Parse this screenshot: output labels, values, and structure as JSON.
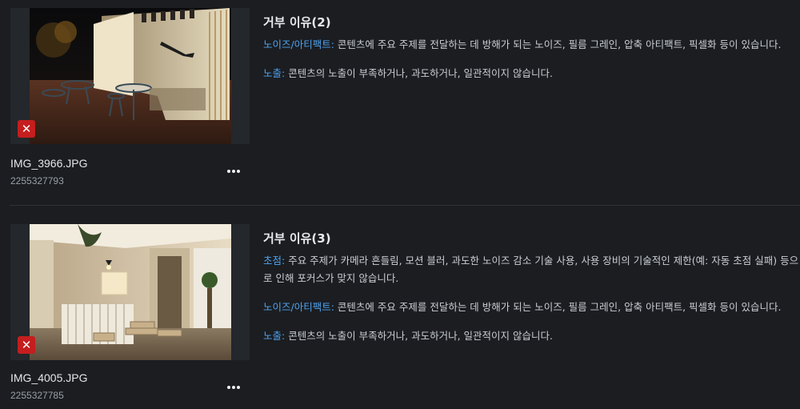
{
  "colors": {
    "background": "#1b1d21",
    "accent_label": "#4ea3f0",
    "reject_badge": "#c41e1e"
  },
  "items": [
    {
      "filename": "IMG_3966.JPG",
      "file_id": "2255327793",
      "reject_icon": "close-icon",
      "more_icon": "more-horizontal-icon",
      "reason_title": "거부 이유(2)",
      "reasons": [
        {
          "label": "노이즈/아티팩트:",
          "text": " 콘텐츠에 주요 주제를 전달하는 데 방해가 되는 노이즈, 필름 그레인, 압축 아티팩트, 픽셀화 등이 있습니다."
        },
        {
          "label": "노출:",
          "text": " 콘텐츠의 노출이 부족하거나, 과도하거나, 일관적이지 않습니다."
        }
      ]
    },
    {
      "filename": "IMG_4005.JPG",
      "file_id": "2255327785",
      "reject_icon": "close-icon",
      "more_icon": "more-horizontal-icon",
      "reason_title": "거부 이유(3)",
      "reasons": [
        {
          "label": "초점:",
          "text": " 주요 주제가 카메라 흔들림, 모션 블러, 과도한 노이즈 감소 기술 사용, 사용 장비의 기술적인 제한(예: 자동 초점 실패) 등으로 인해 포커스가 맞지 않습니다."
        },
        {
          "label": "노이즈/아티팩트:",
          "text": " 콘텐츠에 주요 주제를 전달하는 데 방해가 되는 노이즈, 필름 그레인, 압축 아티팩트, 픽셀화 등이 있습니다."
        },
        {
          "label": "노출:",
          "text": " 콘텐츠의 노출이 부족하거나, 과도하거나, 일관적이지 않습니다."
        }
      ]
    }
  ]
}
